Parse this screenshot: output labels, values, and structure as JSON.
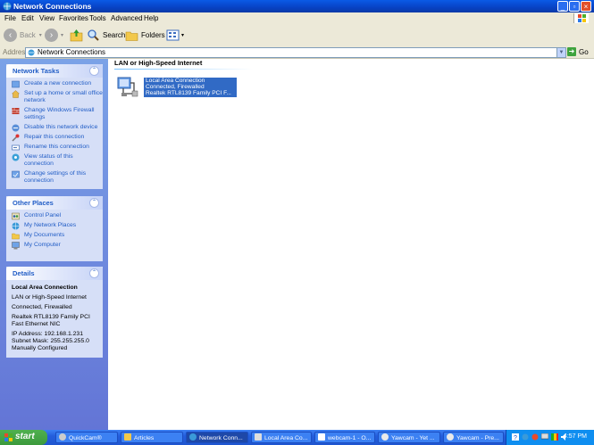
{
  "window": {
    "title": "Network Connections"
  },
  "menu": [
    "File",
    "Edit",
    "View",
    "Favorites",
    "Tools",
    "Advanced",
    "Help"
  ],
  "toolbar": {
    "back_label": "Back",
    "search_label": "Search",
    "folders_label": "Folders"
  },
  "address": {
    "label": "Address",
    "value": "Network Connections",
    "go_label": "Go"
  },
  "network_tasks": {
    "title": "Network Tasks",
    "items": [
      "Create a new connection",
      "Set up a home or small office network",
      "Change Windows Firewall settings",
      "Disable this network device",
      "Repair this connection",
      "Rename this connection",
      "View status of this connection",
      "Change settings of this connection"
    ]
  },
  "other_places": {
    "title": "Other Places",
    "items": [
      "Control Panel",
      "My Network Places",
      "My Documents",
      "My Computer"
    ]
  },
  "details": {
    "title": "Details",
    "name": "Local Area Connection",
    "type": "LAN or High-Speed Internet",
    "status": "Connected, Firewalled",
    "device": "Realtek RTL8139 Family PCI Fast Ethernet NIC",
    "ip": "IP Address: 192.168.1.231",
    "mask": "Subnet Mask: 255.255.255.0",
    "config": "Manually Configured"
  },
  "content": {
    "group_header": "LAN or High-Speed Internet",
    "item": {
      "name": "Local Area Connection",
      "status": "Connected, Firewalled",
      "device": "Realtek RTL8139 Family PCI F..."
    }
  },
  "taskbar": {
    "start_label": "start",
    "buttons": [
      {
        "label": "QuickCam®"
      },
      {
        "label": "Articles"
      },
      {
        "label": "Network Conn..."
      },
      {
        "label": "Local Area Co..."
      },
      {
        "label": "webcam-1 - O..."
      },
      {
        "label": "Yawcam - Yet ..."
      },
      {
        "label": "Yawcam - Pre..."
      }
    ],
    "clock": "4:57 PM"
  },
  "colors": {
    "title_blue": "#0842c4",
    "link_blue": "#215dc6",
    "selection": "#316ac5",
    "start_green": "#3c9a3c"
  }
}
